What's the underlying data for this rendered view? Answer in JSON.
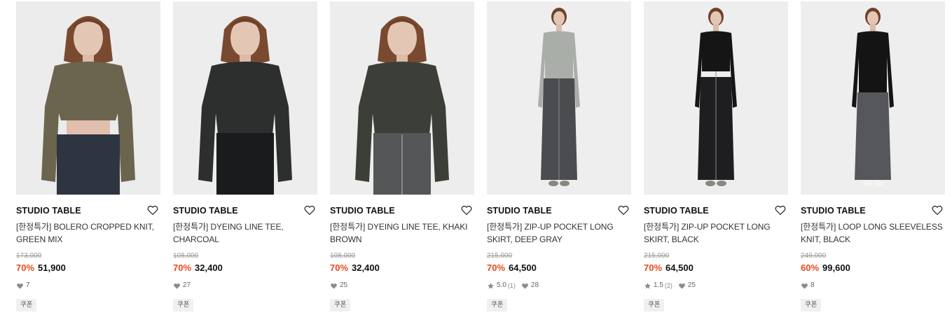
{
  "products": [
    {
      "brand": "STUDIO TABLE",
      "title": "[한정특가] BOLERO CROPPED KNIT, GREEN MIX",
      "original_price": "173,000",
      "discount": "70%",
      "price": "51,900",
      "rating": "",
      "review_count": "",
      "likes": "7",
      "coupon": "쿠폰",
      "colors": {
        "top": "#6b6550",
        "bottom": "#2e3440",
        "bg": "#ececec"
      }
    },
    {
      "brand": "STUDIO TABLE",
      "title": "[한정특가] DYEING LINE TEE, CHARCOAL",
      "original_price": "108,000",
      "discount": "70%",
      "price": "32,400",
      "rating": "",
      "review_count": "",
      "likes": "27",
      "coupon": "쿠폰",
      "colors": {
        "top": "#2d2f2f",
        "bottom": "#1a1b1d",
        "bg": "#ededed"
      }
    },
    {
      "brand": "STUDIO TABLE",
      "title": "[한정특가] DYEING LINE TEE, KHAKI BROWN",
      "original_price": "108,000",
      "discount": "70%",
      "price": "32,400",
      "rating": "",
      "review_count": "",
      "likes": "25",
      "coupon": "쿠폰",
      "colors": {
        "top": "#3c3f38",
        "bottom": "#555657",
        "bg": "#ededed"
      }
    },
    {
      "brand": "STUDIO TABLE",
      "title": "[한정특가] ZIP-UP POCKET LONG SKIRT, DEEP GRAY",
      "original_price": "215,000",
      "discount": "70%",
      "price": "64,500",
      "rating": "5.0",
      "review_count": "(1)",
      "likes": "28",
      "coupon": "쿠폰",
      "colors": {
        "top": "#a9aea8",
        "bottom": "#4a4c4f",
        "bg": "#eeeeee"
      }
    },
    {
      "brand": "STUDIO TABLE",
      "title": "[한정특가] ZIP-UP POCKET LONG SKIRT, BLACK",
      "original_price": "215,000",
      "discount": "70%",
      "price": "64,500",
      "rating": "1.5",
      "review_count": "(2)",
      "likes": "25",
      "coupon": "쿠폰",
      "colors": {
        "top": "#151515",
        "bottom": "#1e1e20",
        "bg": "#eeeeee"
      }
    },
    {
      "brand": "STUDIO TABLE",
      "title": "[한정특가] LOOP LONG SLEEVELESS KNIT, BLACK",
      "original_price": "249,000",
      "discount": "60%",
      "price": "99,600",
      "rating": "",
      "review_count": "",
      "likes": "8",
      "coupon": "쿠폰",
      "colors": {
        "top": "#141414",
        "bottom": "#55575a",
        "bg": "#eeeeee"
      }
    }
  ],
  "icons": {
    "wishlist": "heart-outline-icon",
    "likes": "heart-filled-icon",
    "rating": "star-icon"
  },
  "accent_color": "#e8481a"
}
